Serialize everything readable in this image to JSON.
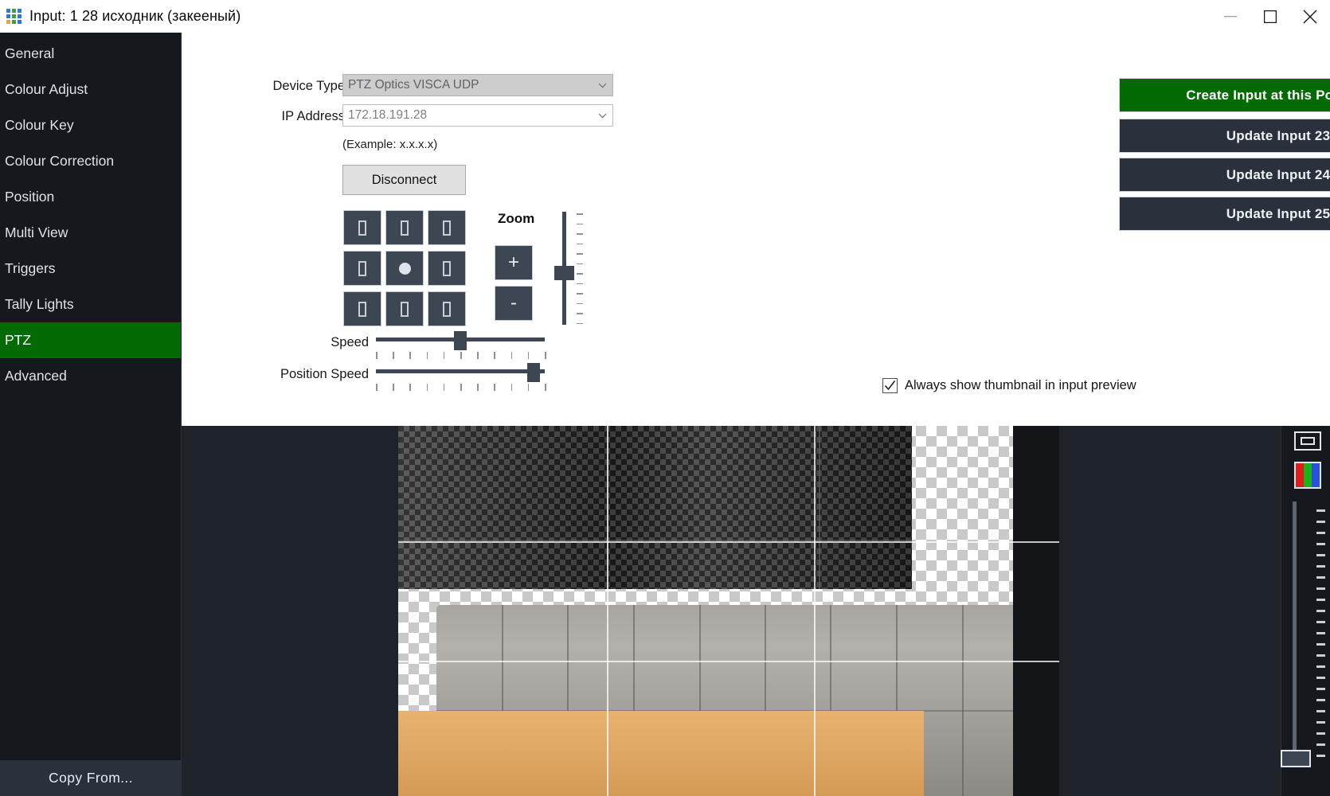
{
  "window": {
    "title": "Input: 1 28 исходник (закееный)",
    "logo_icon": "app-grid-logo-icon",
    "controls": {
      "minimize": "minimize-icon",
      "maximize": "maximize-icon",
      "close": "close-icon"
    }
  },
  "sidebar": {
    "items": [
      {
        "label": "General",
        "active": false
      },
      {
        "label": "Colour Adjust",
        "active": false
      },
      {
        "label": "Colour Key",
        "active": false
      },
      {
        "label": "Colour Correction",
        "active": false
      },
      {
        "label": "Position",
        "active": false
      },
      {
        "label": "Multi View",
        "active": false
      },
      {
        "label": "Triggers",
        "active": false
      },
      {
        "label": "Tally Lights",
        "active": false
      },
      {
        "label": "PTZ",
        "active": true
      },
      {
        "label": "Advanced",
        "active": false
      }
    ],
    "copy_from_label": "Copy From..."
  },
  "ptz": {
    "device_type_label": "Device Type",
    "device_type_value": "PTZ Optics VISCA UDP",
    "ip_address_label": "IP Address",
    "ip_address_value": "172.18.191.28",
    "example_hint": "(Example: x.x.x.x)",
    "disconnect_label": "Disconnect",
    "pad": {
      "up_left": "pan-up-left-button",
      "up": "pan-up-button",
      "up_right": "pan-up-right-button",
      "left": "pan-left-button",
      "home": "pan-home-button",
      "right": "pan-right-button",
      "down_left": "pan-down-left-button",
      "down": "pan-down-button",
      "down_right": "pan-down-right-button"
    },
    "zoom_label": "Zoom",
    "zoom_in_label": "+",
    "zoom_out_label": "-",
    "zoom_slider_percent": 45,
    "speed_label": "Speed",
    "speed_percent": 50,
    "position_speed_label": "Position Speed",
    "position_speed_percent": 97
  },
  "actions": {
    "buttons": [
      {
        "label": "Create Input at this Position",
        "primary": true
      },
      {
        "label": "Update Input 23",
        "primary": false
      },
      {
        "label": "Update Input 24",
        "primary": false
      },
      {
        "label": "Update Input 25",
        "primary": false
      }
    ]
  },
  "options": {
    "thumbnail_checkbox_label": "Always show thumbnail in input preview",
    "thumbnail_checkbox_checked": true
  },
  "rail": {
    "monitor_icon": "monitor-preview-icon",
    "colour_bars_icon": "colour-bars-icon",
    "fader_value_percent": 0
  },
  "colors": {
    "accent_green": "#046a04",
    "panel_bg": "#ffffff",
    "sidebar_bg": "#15181d",
    "button_dark": "#2a313c",
    "control_slate": "#3d4753"
  }
}
